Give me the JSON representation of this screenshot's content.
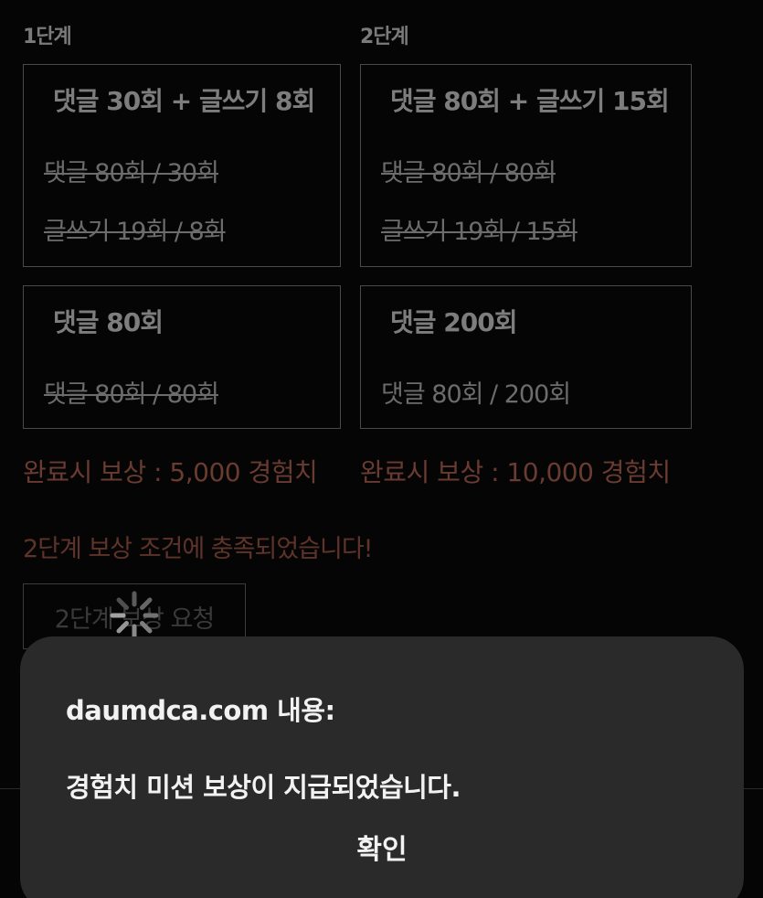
{
  "stages": [
    {
      "label": "1단계",
      "box1": {
        "title": "댓글 30회 + 글쓰기 8회",
        "lines": [
          "댓글 80회 / 30회",
          "글쓰기 19회 / 8회"
        ]
      },
      "box2": {
        "title": "댓글 80회",
        "lines": [
          "댓글 80회 / 80회"
        ]
      },
      "reward": "완료시 보상 : 5,000 경험치"
    },
    {
      "label": "2단계",
      "box1": {
        "title": "댓글 80회 + 글쓰기 15회",
        "lines": [
          "댓글 80회 / 80회",
          "글쓰기 19회 / 15회"
        ]
      },
      "box2": {
        "title": "댓글 200회",
        "lines": [
          "댓글 80회 / 200회"
        ]
      },
      "reward": "완료시 보상 : 10,000 경험치"
    }
  ],
  "notice": "2단계 보상 조건에 충족되었습니다!",
  "request_button": "2단계 보상 요청",
  "dialog": {
    "title": "daumdca.com 내용:",
    "message": "경험치 미션 보상이 지급되었습니다.",
    "ok_label": "확인"
  },
  "colors": {
    "background": "#050505",
    "reward_text": "#6a3b30",
    "dialog_bg": "#2a2a2a"
  }
}
